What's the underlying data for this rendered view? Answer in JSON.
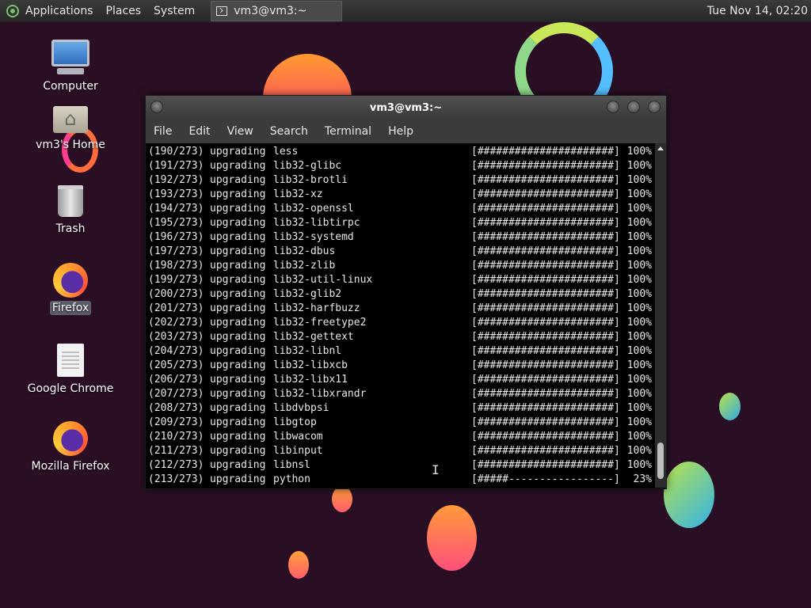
{
  "panel": {
    "applications": "Applications",
    "places": "Places",
    "system": "System",
    "task_title": "vm3@vm3:~",
    "clock": "Tue Nov 14, 02:20"
  },
  "desktop": {
    "icons": [
      {
        "label": "Computer",
        "icon": "computer-icon"
      },
      {
        "label": "vm3's Home",
        "icon": "home-folder-icon"
      },
      {
        "label": "Trash",
        "icon": "trash-icon"
      },
      {
        "label": "Firefox",
        "icon": "firefox-icon",
        "selected": true
      },
      {
        "label": "Google Chrome",
        "icon": "document-icon"
      },
      {
        "label": "Mozilla Firefox",
        "icon": "firefox-icon"
      }
    ]
  },
  "window": {
    "title": "vm3@vm3:~",
    "menu": [
      "File",
      "Edit",
      "View",
      "Search",
      "Terminal",
      "Help"
    ]
  },
  "terminal": {
    "lines": [
      {
        "step": "(190/273)",
        "action": "upgrading",
        "pkg": "less",
        "bar": "[######################]",
        "pct": "100%"
      },
      {
        "step": "(191/273)",
        "action": "upgrading",
        "pkg": "lib32-glibc",
        "bar": "[######################]",
        "pct": "100%"
      },
      {
        "step": "(192/273)",
        "action": "upgrading",
        "pkg": "lib32-brotli",
        "bar": "[######################]",
        "pct": "100%"
      },
      {
        "step": "(193/273)",
        "action": "upgrading",
        "pkg": "lib32-xz",
        "bar": "[######################]",
        "pct": "100%"
      },
      {
        "step": "(194/273)",
        "action": "upgrading",
        "pkg": "lib32-openssl",
        "bar": "[######################]",
        "pct": "100%"
      },
      {
        "step": "(195/273)",
        "action": "upgrading",
        "pkg": "lib32-libtirpc",
        "bar": "[######################]",
        "pct": "100%"
      },
      {
        "step": "(196/273)",
        "action": "upgrading",
        "pkg": "lib32-systemd",
        "bar": "[######################]",
        "pct": "100%"
      },
      {
        "step": "(197/273)",
        "action": "upgrading",
        "pkg": "lib32-dbus",
        "bar": "[######################]",
        "pct": "100%"
      },
      {
        "step": "(198/273)",
        "action": "upgrading",
        "pkg": "lib32-zlib",
        "bar": "[######################]",
        "pct": "100%"
      },
      {
        "step": "(199/273)",
        "action": "upgrading",
        "pkg": "lib32-util-linux",
        "bar": "[######################]",
        "pct": "100%"
      },
      {
        "step": "(200/273)",
        "action": "upgrading",
        "pkg": "lib32-glib2",
        "bar": "[######################]",
        "pct": "100%"
      },
      {
        "step": "(201/273)",
        "action": "upgrading",
        "pkg": "lib32-harfbuzz",
        "bar": "[######################]",
        "pct": "100%"
      },
      {
        "step": "(202/273)",
        "action": "upgrading",
        "pkg": "lib32-freetype2",
        "bar": "[######################]",
        "pct": "100%"
      },
      {
        "step": "(203/273)",
        "action": "upgrading",
        "pkg": "lib32-gettext",
        "bar": "[######################]",
        "pct": "100%"
      },
      {
        "step": "(204/273)",
        "action": "upgrading",
        "pkg": "lib32-libnl",
        "bar": "[######################]",
        "pct": "100%"
      },
      {
        "step": "(205/273)",
        "action": "upgrading",
        "pkg": "lib32-libxcb",
        "bar": "[######################]",
        "pct": "100%"
      },
      {
        "step": "(206/273)",
        "action": "upgrading",
        "pkg": "lib32-libx11",
        "bar": "[######################]",
        "pct": "100%"
      },
      {
        "step": "(207/273)",
        "action": "upgrading",
        "pkg": "lib32-libxrandr",
        "bar": "[######################]",
        "pct": "100%"
      },
      {
        "step": "(208/273)",
        "action": "upgrading",
        "pkg": "libdvbpsi",
        "bar": "[######################]",
        "pct": "100%"
      },
      {
        "step": "(209/273)",
        "action": "upgrading",
        "pkg": "libgtop",
        "bar": "[######################]",
        "pct": "100%"
      },
      {
        "step": "(210/273)",
        "action": "upgrading",
        "pkg": "libwacom",
        "bar": "[######################]",
        "pct": "100%"
      },
      {
        "step": "(211/273)",
        "action": "upgrading",
        "pkg": "libinput",
        "bar": "[######################]",
        "pct": "100%"
      },
      {
        "step": "(212/273)",
        "action": "upgrading",
        "pkg": "libnsl",
        "bar": "[######################]",
        "pct": "100%"
      },
      {
        "step": "(213/273)",
        "action": "upgrading",
        "pkg": "python",
        "bar": "[#####-----------------]",
        "pct": "23%"
      }
    ]
  },
  "colors": {
    "desktop_bg": "#2a0f24",
    "panel_bg": "#2e2e2e",
    "terminal_bg": "#000000",
    "terminal_fg": "#e8e8e8"
  }
}
